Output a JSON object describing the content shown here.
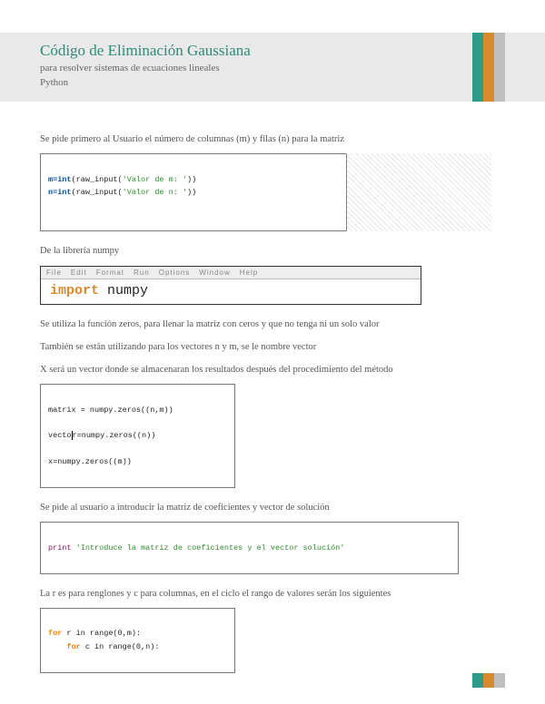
{
  "header": {
    "title": "Código de Eliminación Gaussiana",
    "sub1": "para resolver sistemas de ecuaciones lineales",
    "sub2": "Python"
  },
  "paras": {
    "p1": "Se pide primero al Usuario el número de columnas (m) y filas (n) para la matriz",
    "p2": "De la librería numpy",
    "p3": "Se utiliza la función zeros, para llenar la matriz con ceros y que no tenga ni un solo valor",
    "p4": "También se están utilizando para los vectores n y m, se le nombre vector",
    "p5": "X será un vector donde se almacenaran los resultados después del procedimiento del método",
    "p6": "Se pide al usuario a introducir la matriz de coeficientes y vector de solución",
    "p7": "La r es para renglones y c para columnas, en el ciclo el rango de valores serán los siguientes"
  },
  "code1": {
    "line1_a": "m=int",
    "line1_b": "(raw_input(",
    "line1_c": "'Valor de m: '",
    "line1_d": "))",
    "line2_a": "n=int",
    "line2_b": "(raw_input(",
    "line2_c": "'Valor de n: '",
    "line2_d": "))"
  },
  "menubar": {
    "items": [
      "File",
      "Edit",
      "Format",
      "Run",
      "Options",
      "Window",
      "Help"
    ]
  },
  "importline": {
    "kw": "import",
    "mod": " numpy"
  },
  "code3": {
    "l1": "matrix = numpy.zeros((n,m))",
    "l2a": "vecto",
    "l2b": "r",
    "l2c": "=numpy.zeros((n))",
    "l3": "x=numpy.zeros((m))"
  },
  "code4": {
    "pr": "print",
    "str": " 'Introduce la matriz de coeficientes y el vector solución'"
  },
  "code5": {
    "l1_for": "for",
    "l1_rest": " r in range(0,m):",
    "l2_for": "for",
    "l2_rest": " c in range(0,n):"
  }
}
